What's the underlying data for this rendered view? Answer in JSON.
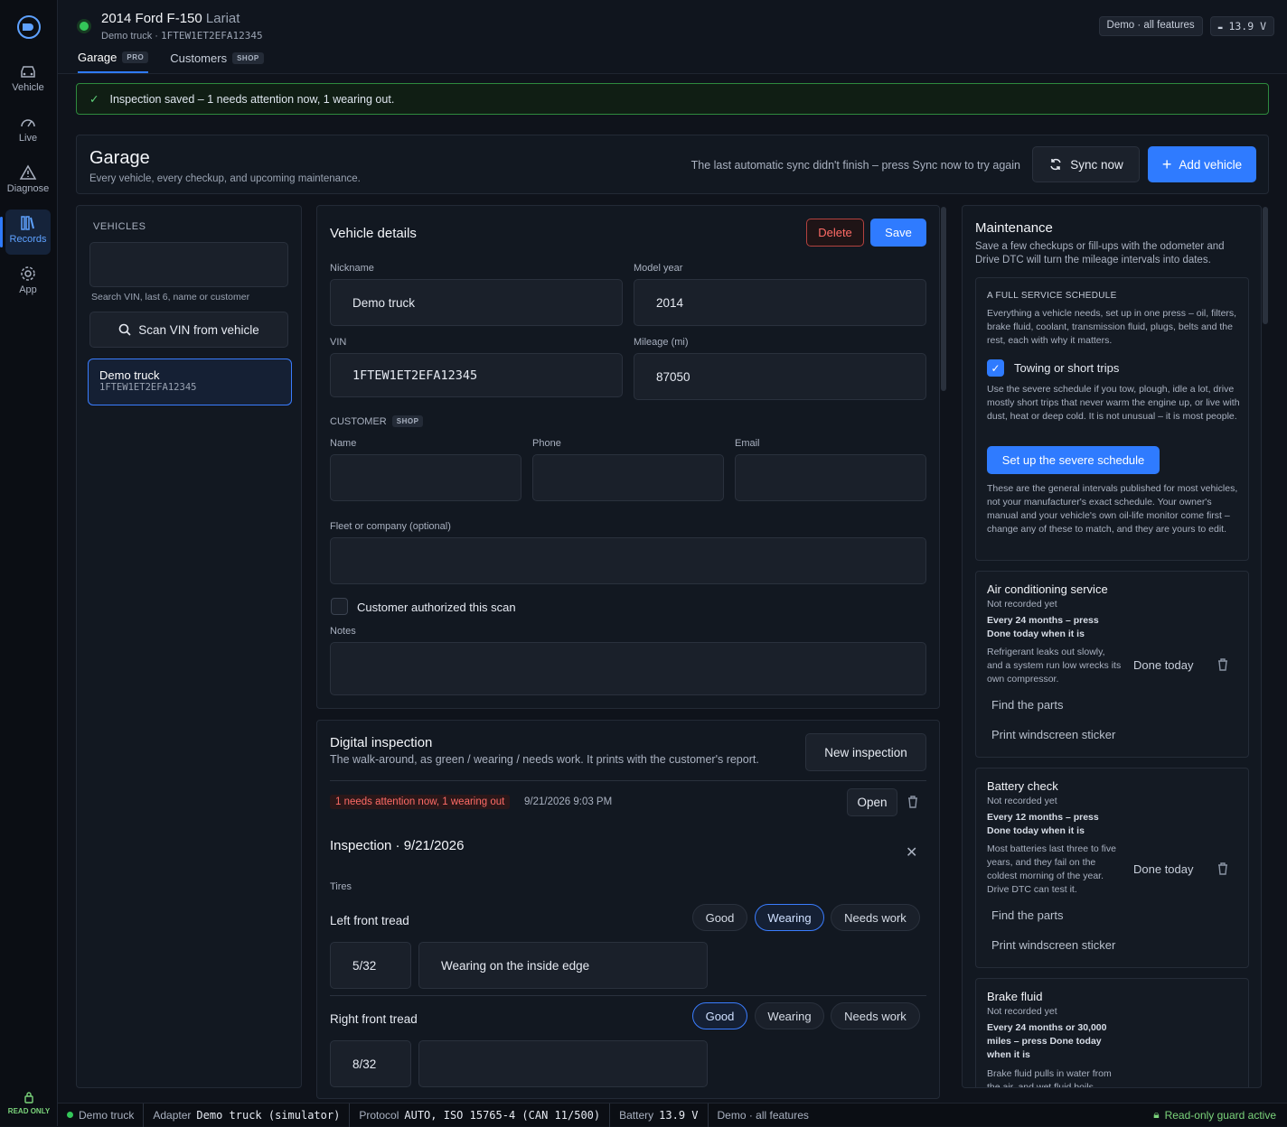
{
  "header": {
    "title": "2014 Ford F-150",
    "trim": "Lariat",
    "nickname": "Demo truck",
    "vin": "1FTEW1ET2EFA12345",
    "demo_badge": "Demo · all features",
    "battery": "13.9 V"
  },
  "tabs": [
    {
      "label": "Garage",
      "badge": "PRO"
    },
    {
      "label": "Customers",
      "badge": "SHOP"
    }
  ],
  "sidebar": [
    {
      "label": "Vehicle",
      "icon": "car-icon"
    },
    {
      "label": "Live",
      "icon": "gauge-icon"
    },
    {
      "label": "Diagnose",
      "icon": "warning-icon"
    },
    {
      "label": "Records",
      "icon": "records-icon"
    },
    {
      "label": "App",
      "icon": "gear-icon"
    }
  ],
  "sidebar_footer": "READ ONLY",
  "toast": "Inspection saved – 1 needs attention now, 1 wearing out.",
  "garage": {
    "title": "Garage",
    "subtitle": "Every vehicle, every checkup, and upcoming maintenance.",
    "sync_note": "The last automatic sync didn't finish – press Sync now to try again",
    "sync_label": "Sync now",
    "add_label": "Add vehicle"
  },
  "vehicles": {
    "heading": "VEHICLES",
    "search_hint": "Search VIN, last 6, name or customer",
    "scan_label": "Scan VIN from vehicle",
    "items": [
      {
        "name": "Demo truck",
        "vin": "1FTEW1ET2EFA12345"
      }
    ]
  },
  "details": {
    "title": "Vehicle details",
    "delete": "Delete",
    "save": "Save",
    "nickname_label": "Nickname",
    "nickname": "Demo truck",
    "year_label": "Model year",
    "year": "2014",
    "vin_label": "VIN",
    "vin": "1FTEW1ET2EFA12345",
    "mileage_label": "Mileage (mi)",
    "mileage": "87050",
    "customer_heading": "CUSTOMER",
    "customer_badge": "SHOP",
    "name_label": "Name",
    "phone_label": "Phone",
    "email_label": "Email",
    "fleet_label": "Fleet or company (optional)",
    "authorized_label": "Customer authorized this scan",
    "notes_label": "Notes"
  },
  "inspection": {
    "title": "Digital inspection",
    "subtitle": "The walk-around, as green / wearing / needs work. It prints with the customer's report.",
    "new_label": "New inspection",
    "summary_badge": "1 needs attention now, 1 wearing out",
    "date": "9/21/2026 9:03 PM",
    "open_label": "Open",
    "detail_title": "Inspection · 9/21/2026",
    "section": "Tires",
    "choices": [
      "Good",
      "Wearing",
      "Needs work"
    ],
    "items": [
      {
        "label": "Left front tread",
        "value": "5/32",
        "note": "Wearing on the inside edge",
        "status": "Wearing"
      },
      {
        "label": "Right front tread",
        "value": "8/32",
        "note": "",
        "status": "Good"
      }
    ]
  },
  "maintenance": {
    "title": "Maintenance",
    "subtitle": "Save a few checkups or fill-ups with the odometer and Drive DTC will turn the mileage intervals into dates.",
    "schedule_heading": "A FULL SERVICE SCHEDULE",
    "schedule_text": "Everything a vehicle needs, set up in one press – oil, filters, brake fluid, coolant, transmission fluid, plugs, belts and the rest, each with why it matters.",
    "towing_label": "Towing or short trips",
    "towing_text": "Use the severe schedule if you tow, plough, idle a lot, drive mostly short trips that never warm the engine up, or live with dust, heat or deep cold. It is not unusual – it is most people.",
    "severe_label": "Set up the severe schedule",
    "disclaimer": "These are the general intervals published for most vehicles, not your manufacturer's exact schedule. Your owner's manual and your vehicle's own oil-life monitor come first – change any of these to match, and they are yours to edit.",
    "items": [
      {
        "name": "Air conditioning service",
        "status": "Not recorded yet",
        "interval": "Every 24 months – press Done today when it is",
        "why": "Refrigerant leaks out slowly, and a system run low wrecks its own compressor.",
        "done": "Done today",
        "parts": "Find the parts",
        "sticker": "Print windscreen sticker"
      },
      {
        "name": "Battery check",
        "status": "Not recorded yet",
        "interval": "Every 12 months – press Done today when it is",
        "why": "Most batteries last three to five years, and they fail on the coldest morning of the year. Drive DTC can test it.",
        "done": "Done today",
        "parts": "Find the parts",
        "sticker": "Print windscreen sticker"
      },
      {
        "name": "Brake fluid",
        "status": "Not recorded yet",
        "interval": "Every 24 months or 30,000 miles – press Done today when it is",
        "why": "Brake fluid pulls in water from the air, and wet fluid boils"
      }
    ]
  },
  "statusbar": {
    "vehicle": "Demo truck",
    "adapter_label": "Adapter",
    "adapter": "Demo truck (simulator)",
    "protocol_label": "Protocol",
    "protocol": "AUTO, ISO 15765-4 (CAN 11/500)",
    "battery_label": "Battery",
    "battery": "13.9 V",
    "mode": "Demo · all features",
    "guard": "Read-only guard active"
  }
}
